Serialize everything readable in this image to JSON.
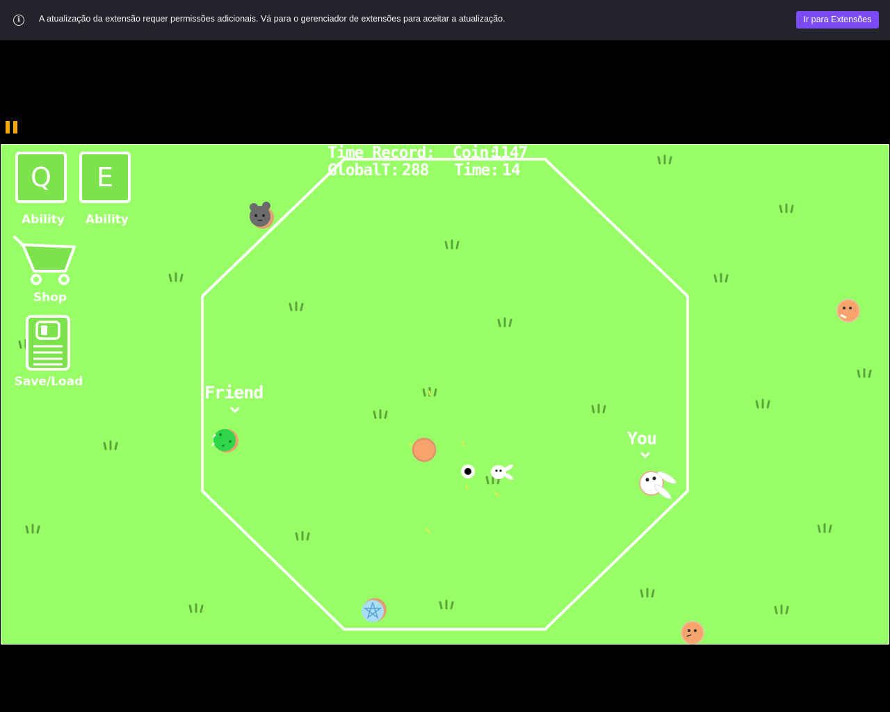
{
  "banner": {
    "icon": "info-icon",
    "message": "A atualização da extensão requer permissões adicionais. Vá para o gerenciador de extensões para aceitar a atualização.",
    "button_label": "Ir para Extensões",
    "button_color": "#7b4cf5"
  },
  "pause_icon": "pause-icon",
  "hud": {
    "q_key": "Q",
    "e_key": "E",
    "q_label": "Ability",
    "e_label": "Ability",
    "shop_label": "Shop",
    "saveload_label": "Save/Load",
    "time_record_label": "Time Record:",
    "global_label": "GlobalT:",
    "global_value": "288",
    "coin_label": "Coin:",
    "coin_value": "1147",
    "time_label": "Time:",
    "time_value": "14"
  },
  "world": {
    "friend_label": "Friend",
    "you_label": "You",
    "grass_color": "#99ff66",
    "tuft_color": "#5aa63a"
  }
}
